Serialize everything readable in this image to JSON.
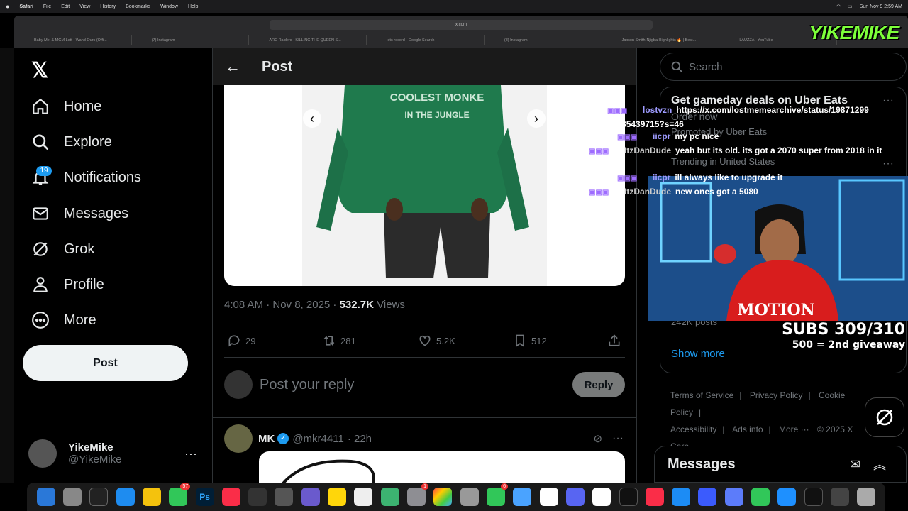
{
  "menubar": {
    "app": "Safari",
    "items": [
      "File",
      "Edit",
      "View",
      "History",
      "Bookmarks",
      "Window",
      "Help"
    ],
    "clock": "Sun Nov 9  2:59 AM"
  },
  "browser": {
    "url": "x.com",
    "tabs": [
      "Baby Mel & MGM Lett - Wand Ours (Offi...",
      "(7) Instagram",
      "ARC Raiders - KILLING THE QUEEN S...",
      "jets record - Google Search",
      "(8) Instagram",
      "Jaxson Smith-Njigba Highlights 🔥 | Best...",
      "LAUZZA - YouTube"
    ]
  },
  "sidebar": {
    "nav": [
      {
        "label": "Home",
        "icon": "home-icon"
      },
      {
        "label": "Explore",
        "icon": "search-icon"
      },
      {
        "label": "Notifications",
        "icon": "bell-icon"
      },
      {
        "label": "Messages",
        "icon": "mail-icon"
      },
      {
        "label": "Grok",
        "icon": "grok-icon"
      },
      {
        "label": "Profile",
        "icon": "person-icon"
      },
      {
        "label": "More",
        "icon": "more-circle-icon"
      }
    ],
    "notifications_count": "19",
    "post_button": "Post",
    "account": {
      "name": "YikeMike",
      "handle": "@YikeMike"
    }
  },
  "post": {
    "header_title": "Post",
    "image_text": [
      "COOLEST MONKE",
      "IN THE JUNGLE"
    ],
    "meta": {
      "time": "4:08 AM · Nov 8, 2025 · ",
      "views_count": "532.7K",
      "views_label": " Views"
    },
    "actions": {
      "replies": "29",
      "reposts": "281",
      "likes": "5.2K",
      "bookmarks": "512"
    },
    "reply_placeholder": "Post your reply",
    "reply_button": "Reply"
  },
  "next_post": {
    "name": "MK",
    "handle": "@mkr4411",
    "time": "· 22h"
  },
  "right": {
    "search_placeholder": "Search",
    "promo_title": "Get gameday deals on Uber Eats",
    "promo_sub": "Order now",
    "promoted_by": "Promoted by Uber Eats",
    "trending_loc": "Trending in United States",
    "posts_count": "242K posts",
    "show_more": "Show more",
    "footer": [
      "Terms of Service",
      "|",
      "Privacy Policy",
      "|",
      "Cookie Policy",
      "|",
      "Accessibility",
      "|",
      "Ads info",
      "|",
      "More ···",
      "© 2025 X Corp."
    ],
    "messages": "Messages"
  },
  "chat": [
    {
      "user": "lostvzn",
      "text": "https://x.com/lostmemearchive/status/19871299 77385439715?s=46"
    },
    {
      "user": "iicpr",
      "text": "my pc nice"
    },
    {
      "user": "ItzDanDude",
      "text": "yeah but its old. its got a 2070 super from 2018 in it lmao"
    },
    {
      "user": "iicpr",
      "text": "ill always like to upgrade it"
    },
    {
      "user": "ItzDanDude",
      "text": "new ones got a 5080"
    }
  ],
  "stream": {
    "logo": "YIKEMIKE",
    "subs": "SUBS 309/310",
    "giveaway": "500 = 2nd giveaway",
    "hoodie_text": "MOTION"
  },
  "dock_badges": {
    "messages": "57",
    "settings": "1",
    "facetime": "6"
  },
  "colors": {
    "accent": "#1d9bf0",
    "bg": "#000000",
    "text": "#e7e9ea",
    "muted": "#71767b",
    "logo_green": "#7dff3a"
  }
}
